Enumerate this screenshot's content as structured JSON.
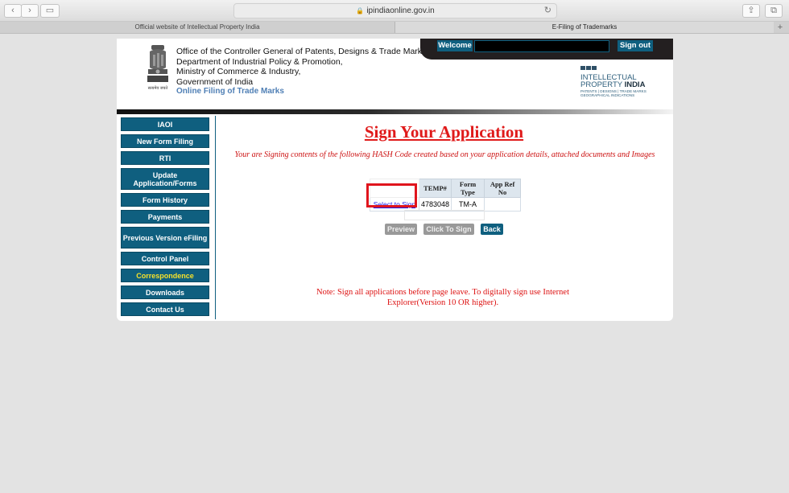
{
  "browser": {
    "url": "ipindiaonline.gov.in",
    "tabs": [
      {
        "label": "Official website of Intellectual Property India"
      },
      {
        "label": "E-Filing of Trademarks"
      }
    ]
  },
  "header": {
    "office_lines": [
      "Office of the Controller General of Patents, Designs & Trade Marks",
      "Department of Industrial Policy & Promotion,",
      "Ministry of Commerce & Industry,",
      "Government of India"
    ],
    "online_filing": "Online Filing of Trade Marks",
    "emblem_caption": "सत्यमेव जयते",
    "welcome_label": "Welcome",
    "signout_label": "Sign out",
    "ipi_logo": {
      "line1": "INTELLECTUAL",
      "line2a": "PROPERTY ",
      "line2b": "INDIA",
      "line3": "PATENTS | DESIGNS | TRADE MARKS",
      "line4": "GEOGRAPHICAL INDICATIONS"
    }
  },
  "sidebar": {
    "items": [
      {
        "label": "IAOI"
      },
      {
        "label": "New Form Filing"
      },
      {
        "label": "RTI"
      },
      {
        "label": "Update Application/Forms"
      },
      {
        "label": "Form History"
      },
      {
        "label": "Payments"
      },
      {
        "label": "Previous Version eFiling"
      },
      {
        "label": "Control Panel"
      },
      {
        "label": "Correspondence",
        "active": true
      },
      {
        "label": "Downloads"
      },
      {
        "label": "Contact Us"
      }
    ]
  },
  "main": {
    "title": "Sign Your Application",
    "hash_message": "Your are Signing contents of the following HASH Code created based on your application details, attached documents and Images",
    "table": {
      "headers": [
        "",
        "TEMP#",
        "Form Type",
        "App Ref No"
      ],
      "rows": [
        {
          "select_label": "Select to Sign",
          "temp": "4783048",
          "form_type": "TM-A",
          "app_ref": ""
        }
      ]
    },
    "buttons": {
      "preview": "Preview",
      "click_to_sign": "Click To Sign",
      "back": "Back"
    },
    "note": "Note: Sign all applications before page leave. To digitally sign use Internet Explorer(Version 10 OR higher)."
  },
  "colors": {
    "brand_teal": "#0f5f7f",
    "title_red": "#e01a1a",
    "highlight_red": "#e0151d",
    "active_yellow": "#f5e12a"
  }
}
